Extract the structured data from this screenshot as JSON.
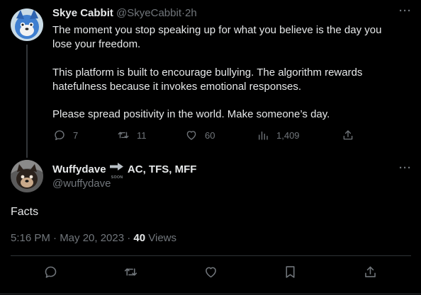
{
  "first_tweet": {
    "display_name": "Skye Cabbit",
    "handle": "@SkyeCabbit",
    "separator": "·",
    "time": "2h",
    "more": "···",
    "lines": [
      "The moment you stop speaking up for what you believe is the day you",
      "lose your freedom.",
      "This platform is built to encourage bullying. The algorithm rewards",
      "hatefulness because it invokes emotional responses.",
      "Please spread positivity in the world. Make someone’s day."
    ],
    "counts": {
      "replies": "7",
      "retweets": "11",
      "likes": "60",
      "views": "1,409"
    }
  },
  "main_tweet": {
    "display_name": "Wuffydave",
    "soon_badge": "SOON",
    "name_suffix": "AC, TFS, MFF",
    "handle": "@wuffydave",
    "more": "···",
    "text": "Facts",
    "timestamp": "5:16 PM · May 20, 2023 · ",
    "views_count": "40",
    "views_label": " Views"
  },
  "icons": {
    "reply": "reply-icon",
    "retweet": "retweet-icon",
    "like": "heart-icon",
    "views": "analytics-icon",
    "share": "share-icon",
    "bookmark": "bookmark-icon",
    "soon_arrow": "soon-arrow-icon"
  },
  "colors": {
    "background": "#000000",
    "text": "#e7e9ea",
    "muted": "#71767b",
    "divider": "#2f3336"
  }
}
